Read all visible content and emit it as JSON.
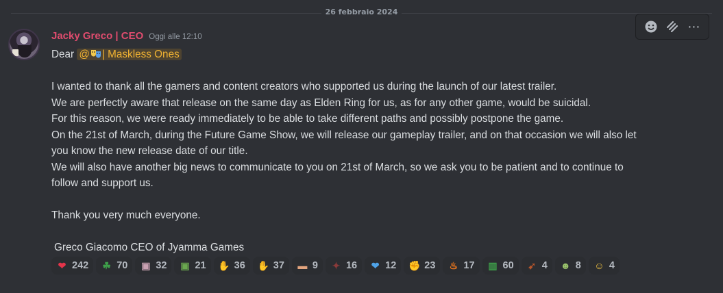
{
  "date_divider": "26 febbraio 2024",
  "message": {
    "author": "Jacky Greco | CEO",
    "timestamp": "Oggi alle 12:10",
    "greeting_prefix": "Dear",
    "mention_at": "@",
    "mention_text": "| Maskless Ones",
    "lines": [
      "I wanted to thank all the gamers and content creators who supported us during the launch of our latest trailer.",
      "We are perfectly aware that release on the same day as Elden Ring for us, as for any other game, would be suicidal.",
      "For this reason, we were ready immediately to be able to take different paths and possibly postpone the game.",
      "On the 21st of March, during the Future Game Show, we will release our gameplay trailer, and on that occasion we will also let",
      "you know the new release date of our title.",
      "We will also have another big news to communicate to you on 21st of March, so we ask you to be patient and to continue to",
      "follow and support us."
    ],
    "thanks": "Thank you very much everyone.",
    "signature": "Greco Giacomo CEO of Jyamma Games"
  },
  "toolbar": {
    "icons": [
      "add-reaction-icon",
      "hyperlink-icon",
      "more-options-icon"
    ],
    "more_label": "⋯"
  },
  "reactions": [
    {
      "icon": "red-heart-icon",
      "glyph": "❤",
      "color": "#e5344a",
      "count": "242"
    },
    {
      "icon": "four-leaf-clover-icon",
      "glyph": "☘",
      "color": "#3ea04a",
      "count": "70"
    },
    {
      "icon": "custom-emoji-icon",
      "glyph": "▣",
      "color": "#c9a1b2",
      "count": "32"
    },
    {
      "icon": "custom-emoji-icon",
      "glyph": "▣",
      "color": "#6aa84f",
      "count": "21"
    },
    {
      "icon": "folded-hands-icon",
      "glyph": "✋",
      "color": "#f4c542",
      "count": "36"
    },
    {
      "icon": "clapping-hands-icon",
      "glyph": "✋",
      "color": "#f4c542",
      "count": "37"
    },
    {
      "icon": "bandage-icon",
      "glyph": "▬",
      "color": "#e3a47e",
      "count": "9"
    },
    {
      "icon": "custom-emoji-icon",
      "glyph": "✦",
      "color": "#8a3a3a",
      "count": "16"
    },
    {
      "icon": "blue-heart-icon",
      "glyph": "❤",
      "color": "#4fa3e8",
      "count": "12"
    },
    {
      "icon": "thumbs-up-icon",
      "glyph": "✊",
      "color": "#f4c542",
      "count": "23"
    },
    {
      "icon": "fire-icon",
      "glyph": "♨",
      "color": "#f77b1c",
      "count": "17"
    },
    {
      "icon": "italy-flag-icon",
      "glyph": "▥",
      "color": "#3ea04a",
      "count": "60"
    },
    {
      "icon": "custom-emoji-icon",
      "glyph": "➹",
      "color": "#b5552b",
      "count": "4"
    },
    {
      "icon": "performing-arts-icon",
      "glyph": "☻",
      "color": "#9bc46c",
      "count": "8"
    },
    {
      "icon": "smiling-tear-face-icon",
      "glyph": "☺",
      "color": "#f4c542",
      "count": "4"
    }
  ]
}
